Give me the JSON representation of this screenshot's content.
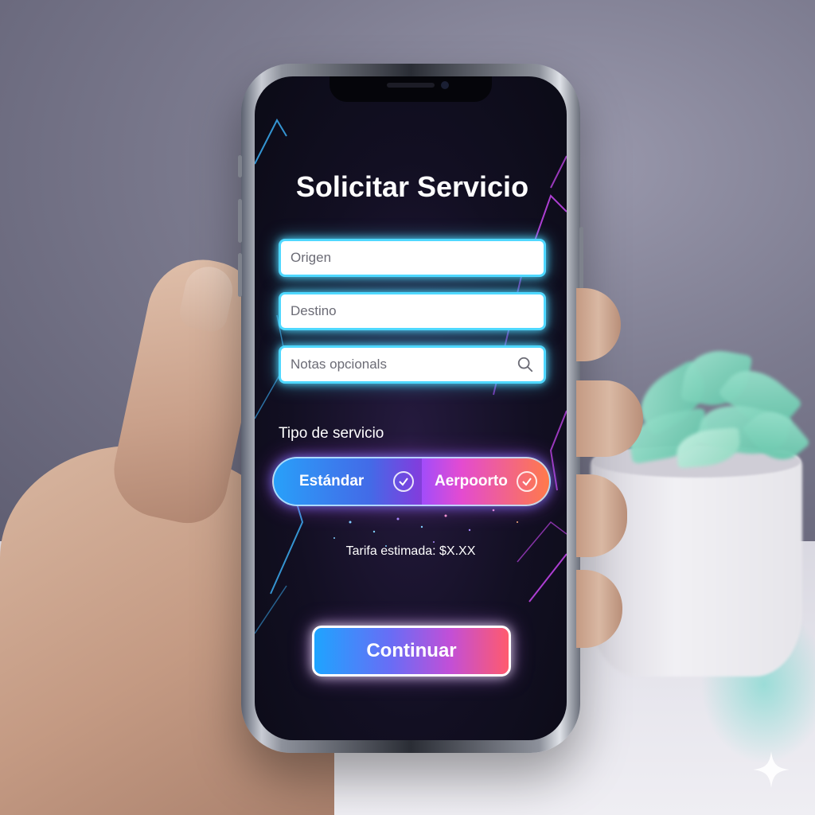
{
  "screen": {
    "title": "Solicitar Servicio",
    "fields": [
      {
        "placeholder": "Origen",
        "value": ""
      },
      {
        "placeholder": "Destino",
        "value": ""
      },
      {
        "placeholder": "Notas opcionals",
        "value": "",
        "icon": "search-icon"
      }
    ],
    "service_type": {
      "label": "Tipo de servicio",
      "options": [
        {
          "label": "Estándar",
          "icon": "check-circle-icon"
        },
        {
          "label": "Aerpoorto",
          "icon": "check-circle-icon"
        }
      ]
    },
    "fare_text": "Tarifa estimada: $X.XX",
    "continue_label": "Continuar"
  },
  "colors": {
    "field_glow": "#4fd8ff",
    "accent_blue": "#1ea4ff",
    "accent_pink": "#e34bd1",
    "accent_orange": "#ff7a4a",
    "screen_bg": "#120f22"
  },
  "overlay_icon": "sparkle-icon"
}
